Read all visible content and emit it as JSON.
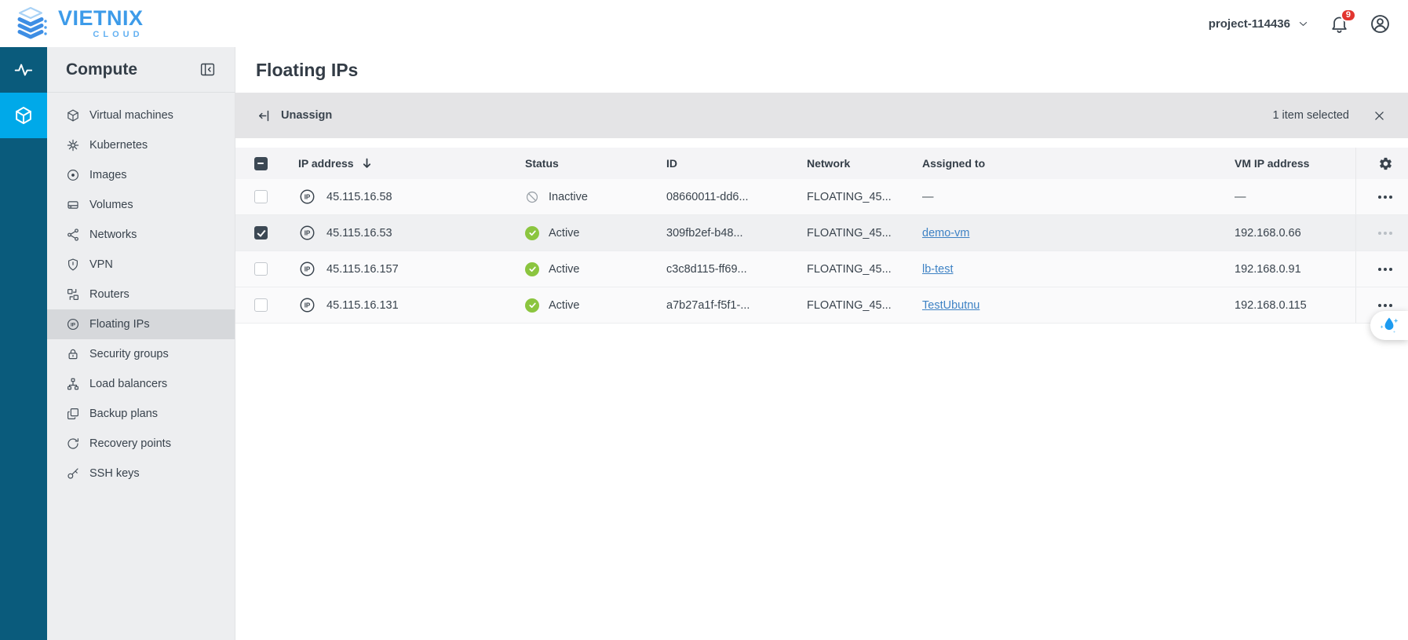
{
  "brand": {
    "name": "VIETNIX",
    "sub": "CLOUD"
  },
  "topbar": {
    "project_label": "project-114436",
    "notification_count": "9"
  },
  "sidebar": {
    "title": "Compute",
    "items": [
      {
        "label": "Virtual machines",
        "icon": "cube",
        "active": false
      },
      {
        "label": "Kubernetes",
        "icon": "helm",
        "active": false
      },
      {
        "label": "Images",
        "icon": "disc",
        "active": false
      },
      {
        "label": "Volumes",
        "icon": "drive",
        "active": false
      },
      {
        "label": "Networks",
        "icon": "network",
        "active": false
      },
      {
        "label": "VPN",
        "icon": "shield",
        "active": false
      },
      {
        "label": "Routers",
        "icon": "router",
        "active": false
      },
      {
        "label": "Floating IPs",
        "icon": "ip-circle",
        "active": true
      },
      {
        "label": "Security groups",
        "icon": "lock",
        "active": false
      },
      {
        "label": "Load balancers",
        "icon": "hierarchy",
        "active": false
      },
      {
        "label": "Backup plans",
        "icon": "copy",
        "active": false
      },
      {
        "label": "Recovery points",
        "icon": "refresh",
        "active": false
      },
      {
        "label": "SSH keys",
        "icon": "key",
        "active": false
      }
    ]
  },
  "page": {
    "title": "Floating IPs"
  },
  "toolbar": {
    "unassign_label": "Unassign",
    "selection_text": "1 item selected"
  },
  "table": {
    "columns": {
      "ip": "IP address",
      "status": "Status",
      "id": "ID",
      "network": "Network",
      "assigned": "Assigned to",
      "vm_ip": "VM IP address"
    },
    "rows": [
      {
        "ip": "45.115.16.58",
        "status": "Inactive",
        "id": "08660011-dd6...",
        "network": "FLOATING_45...",
        "assigned_to": "—",
        "vm_ip": "—",
        "selected": false
      },
      {
        "ip": "45.115.16.53",
        "status": "Active",
        "id": "309fb2ef-b48...",
        "network": "FLOATING_45...",
        "assigned_to": "demo-vm",
        "vm_ip": "192.168.0.66",
        "selected": true
      },
      {
        "ip": "45.115.16.157",
        "status": "Active",
        "id": "c3c8d115-ff69...",
        "network": "FLOATING_45...",
        "assigned_to": "lb-test",
        "vm_ip": "192.168.0.91",
        "selected": false
      },
      {
        "ip": "45.115.16.131",
        "status": "Active",
        "id": "a7b27a1f-f5f1-...",
        "network": "FLOATING_45...",
        "assigned_to": "TestUbutnu",
        "vm_ip": "192.168.0.115",
        "selected": false
      }
    ]
  },
  "colors": {
    "rail": "#0A5B7C",
    "rail_active": "#00A9E9",
    "brand": "#3D9BE9",
    "brand_light": "#63B1F2",
    "status_active": "#8BC53F",
    "status_inactive": "#9AA1A8",
    "link": "#3E82C4",
    "badge": "#E2352F",
    "checkbox": "#3C4854"
  }
}
